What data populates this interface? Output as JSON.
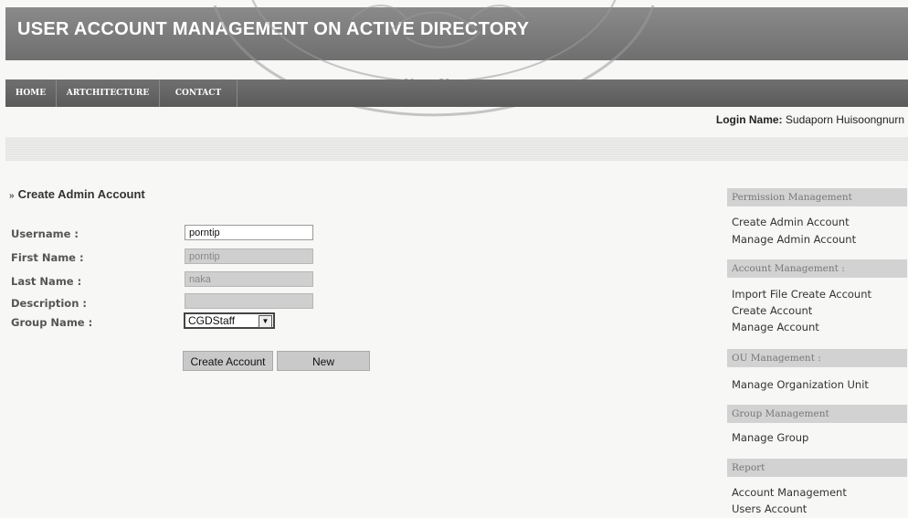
{
  "header": {
    "title": "USER ACCOUNT MANAGEMENT ON ACTIVE DIRECTORY"
  },
  "nav": {
    "items": [
      "HOME",
      "ARTCHITECTURE",
      "CONTACT"
    ]
  },
  "login": {
    "label": "Login Name:",
    "name": "Sudaporn Huisoongnurn"
  },
  "seal": {
    "text": "พระจอมเกล้าเจ้าคุณทหาร"
  },
  "main": {
    "section_title": "Create Admin Account",
    "fields": [
      {
        "label": "Username :",
        "value": "porntip"
      },
      {
        "label": "First Name :",
        "value": "porntip"
      },
      {
        "label": "Last Name :",
        "value": "naka"
      },
      {
        "label": "Description :",
        "value": ""
      },
      {
        "label": "Group Name :",
        "value": "CGDStaff"
      }
    ],
    "buttons": {
      "create": "Create Account",
      "new": "New"
    }
  },
  "sidebar": {
    "sections": [
      {
        "heading": "Permission Management",
        "links": [
          "Create Admin Account",
          "Manage Admin Account"
        ]
      },
      {
        "heading": "Account Management :",
        "links": [
          "Import File Create Account",
          "Create Account",
          "Manage Account"
        ]
      },
      {
        "heading": "OU Management :",
        "links": [
          "Manage Organization Unit"
        ]
      },
      {
        "heading": "Group Management",
        "links": [
          "Manage Group"
        ]
      },
      {
        "heading": "Report",
        "links": [
          "Account Management",
          "Users Account"
        ]
      }
    ]
  }
}
